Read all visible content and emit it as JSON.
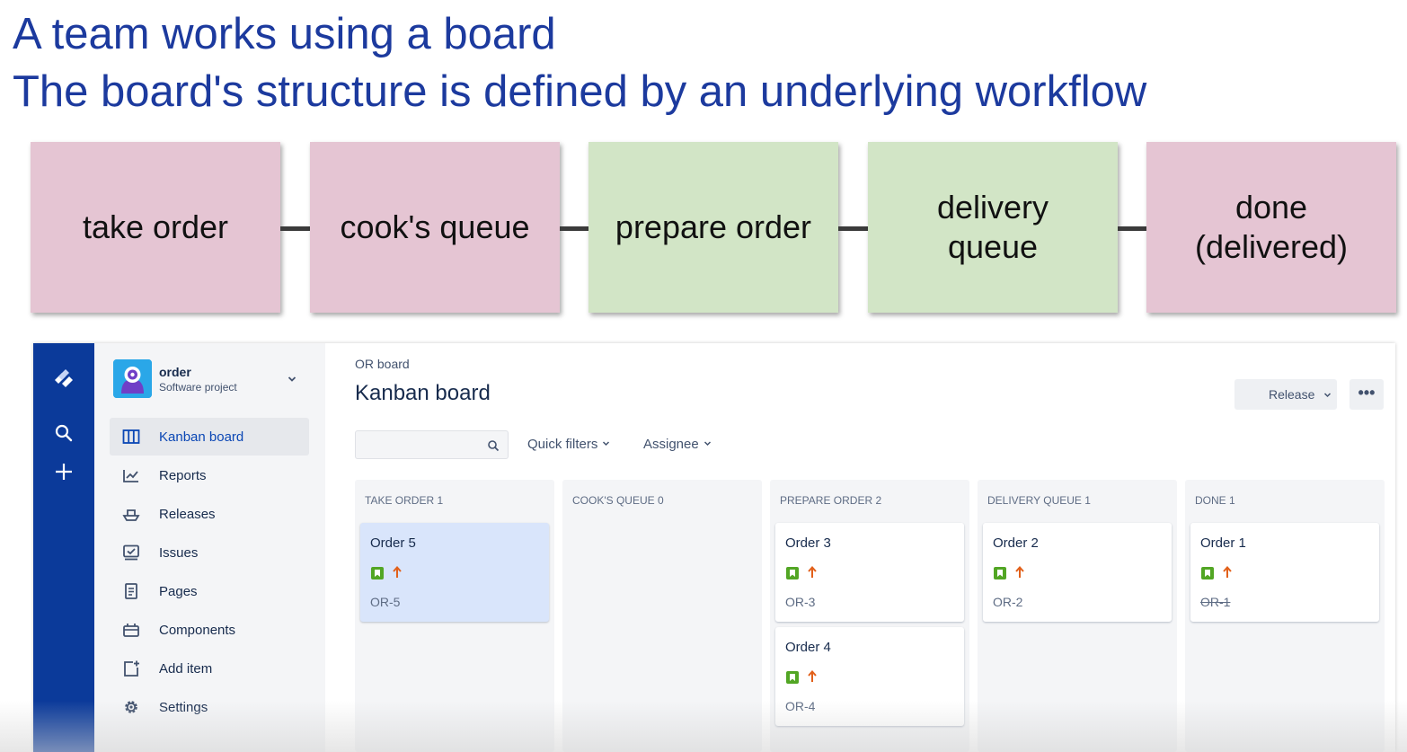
{
  "slide": {
    "heading_line1": "A team works using a board",
    "heading_line2": "The board's structure is defined by an underlying workflow"
  },
  "workflow": {
    "steps": [
      {
        "label": "take order",
        "color": "#e5c5d3"
      },
      {
        "label": "cook's queue",
        "color": "#e5c5d3"
      },
      {
        "label": "prepare order",
        "color": "#d2e5c6"
      },
      {
        "label": "delivery queue",
        "color": "#d2e5c6"
      },
      {
        "label": "done (delivered)",
        "color": "#e5c5d3"
      }
    ]
  },
  "colors": {
    "heading": "#1c3a9e",
    "global_nav": "#0b3a9a",
    "project_nav": "#f4f5f7",
    "active_link": "#0b47b5",
    "story_icon": "#52a624",
    "priority_icon": "#e2601a",
    "selected_card": "#d9e5fb"
  },
  "project": {
    "name": "order",
    "type": "Software project"
  },
  "nav": {
    "items": [
      {
        "label": "Kanban board",
        "icon": "board-icon"
      },
      {
        "label": "Reports",
        "icon": "reports-icon"
      },
      {
        "label": "Releases",
        "icon": "releases-icon"
      },
      {
        "label": "Issues",
        "icon": "issues-icon"
      },
      {
        "label": "Pages",
        "icon": "pages-icon"
      },
      {
        "label": "Components",
        "icon": "components-icon"
      },
      {
        "label": "Add item",
        "icon": "add-item-icon"
      },
      {
        "label": "Settings",
        "icon": "settings-icon"
      }
    ]
  },
  "board": {
    "breadcrumb": "OR board",
    "title": "Kanban board",
    "release_label": "Release",
    "more_label": "•••",
    "search_placeholder": "",
    "quick_filters_label": "Quick filters",
    "assignee_label": "Assignee",
    "columns": [
      {
        "header": "TAKE ORDER 1",
        "cards": [
          {
            "title": "Order 5",
            "key": "OR-5"
          }
        ]
      },
      {
        "header": "COOK'S QUEUE 0",
        "cards": []
      },
      {
        "header": "PREPARE ORDER 2",
        "cards": [
          {
            "title": "Order 3",
            "key": "OR-3"
          },
          {
            "title": "Order 4",
            "key": "OR-4"
          }
        ]
      },
      {
        "header": "DELIVERY QUEUE 1",
        "cards": [
          {
            "title": "Order 2",
            "key": "OR-2"
          }
        ]
      },
      {
        "header": "DONE 1",
        "cards": [
          {
            "title": "Order 1",
            "key": "OR-1"
          }
        ]
      }
    ]
  }
}
